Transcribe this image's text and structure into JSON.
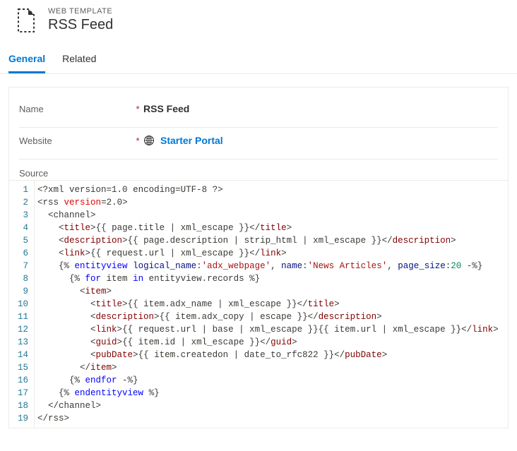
{
  "header": {
    "category": "WEB TEMPLATE",
    "title": "RSS Feed"
  },
  "tabs": {
    "general": "General",
    "related": "Related"
  },
  "fields": {
    "name_label": "Name",
    "name_value": "RSS Feed",
    "website_label": "Website",
    "website_value": "Starter Portal",
    "source_label": "Source"
  },
  "code": {
    "lines": [
      {
        "n": 1,
        "indent": 0,
        "segs": [
          {
            "t": "<?",
            "c": "t-pun"
          },
          {
            "t": "xml version",
            "c": "t-dk"
          },
          {
            "t": "=",
            "c": "t-pun"
          },
          {
            "t": "1.0",
            "c": "t-dk"
          },
          {
            "t": " encoding",
            "c": "t-dk"
          },
          {
            "t": "=",
            "c": "t-pun"
          },
          {
            "t": "UTF-8",
            "c": "t-dk"
          },
          {
            "t": " ?>",
            "c": "t-pun"
          }
        ]
      },
      {
        "n": 2,
        "indent": 0,
        "segs": [
          {
            "t": "<",
            "c": "t-pun"
          },
          {
            "t": "rss",
            "c": "t-dk"
          },
          {
            "t": " ",
            "c": ""
          },
          {
            "t": "version",
            "c": "t-attr"
          },
          {
            "t": "=",
            "c": "t-pun"
          },
          {
            "t": "2.0",
            "c": "t-dk"
          },
          {
            "t": ">",
            "c": "t-pun"
          }
        ]
      },
      {
        "n": 3,
        "indent": 1,
        "segs": [
          {
            "t": "<",
            "c": "t-pun"
          },
          {
            "t": "channel",
            "c": "t-dk"
          },
          {
            "t": ">",
            "c": "t-pun"
          }
        ]
      },
      {
        "n": 4,
        "indent": 2,
        "segs": [
          {
            "t": "<",
            "c": "t-pun"
          },
          {
            "t": "title",
            "c": "t-tag"
          },
          {
            "t": ">",
            "c": "t-pun"
          },
          {
            "t": "{{ page.title | xml_escape }}",
            "c": "t-dk"
          },
          {
            "t": "</",
            "c": "t-pun"
          },
          {
            "t": "title",
            "c": "t-tag"
          },
          {
            "t": ">",
            "c": "t-pun"
          }
        ]
      },
      {
        "n": 5,
        "indent": 2,
        "segs": [
          {
            "t": "<",
            "c": "t-pun"
          },
          {
            "t": "description",
            "c": "t-tag"
          },
          {
            "t": ">",
            "c": "t-pun"
          },
          {
            "t": "{{ page.description | strip_html | xml_escape }}",
            "c": "t-dk"
          },
          {
            "t": "</",
            "c": "t-pun"
          },
          {
            "t": "description",
            "c": "t-tag"
          },
          {
            "t": ">",
            "c": "t-pun"
          }
        ]
      },
      {
        "n": 6,
        "indent": 2,
        "segs": [
          {
            "t": "<",
            "c": "t-pun"
          },
          {
            "t": "link",
            "c": "t-tag"
          },
          {
            "t": ">",
            "c": "t-pun"
          },
          {
            "t": "{{ request.url | xml_escape }}",
            "c": "t-dk"
          },
          {
            "t": "</",
            "c": "t-pun"
          },
          {
            "t": "link",
            "c": "t-tag"
          },
          {
            "t": ">",
            "c": "t-pun"
          }
        ]
      },
      {
        "n": 7,
        "indent": 2,
        "segs": [
          {
            "t": "{% ",
            "c": "t-pct"
          },
          {
            "t": "entityview",
            "c": "t-kw"
          },
          {
            "t": " ",
            "c": ""
          },
          {
            "t": "logical_name",
            "c": "t-var"
          },
          {
            "t": ":",
            "c": "t-pun"
          },
          {
            "t": "'adx_webpage'",
            "c": "t-str"
          },
          {
            "t": ", ",
            "c": "t-pun"
          },
          {
            "t": "name",
            "c": "t-var"
          },
          {
            "t": ":",
            "c": "t-pun"
          },
          {
            "t": "'News Articles'",
            "c": "t-str"
          },
          {
            "t": ", ",
            "c": "t-pun"
          },
          {
            "t": "page_size",
            "c": "t-var"
          },
          {
            "t": ":",
            "c": "t-pun"
          },
          {
            "t": "20",
            "c": "t-num"
          },
          {
            "t": " -%}",
            "c": "t-pct"
          }
        ]
      },
      {
        "n": 8,
        "indent": 3,
        "segs": [
          {
            "t": "{% ",
            "c": "t-pct"
          },
          {
            "t": "for",
            "c": "t-kw"
          },
          {
            "t": " item ",
            "c": "t-dk"
          },
          {
            "t": "in",
            "c": "t-kw"
          },
          {
            "t": " entityview.records ",
            "c": "t-dk"
          },
          {
            "t": "%}",
            "c": "t-pct"
          }
        ]
      },
      {
        "n": 9,
        "indent": 4,
        "segs": [
          {
            "t": "<",
            "c": "t-pun"
          },
          {
            "t": "item",
            "c": "t-tag"
          },
          {
            "t": ">",
            "c": "t-pun"
          }
        ]
      },
      {
        "n": 10,
        "indent": 5,
        "segs": [
          {
            "t": "<",
            "c": "t-pun"
          },
          {
            "t": "title",
            "c": "t-tag"
          },
          {
            "t": ">",
            "c": "t-pun"
          },
          {
            "t": "{{ item.adx_name | xml_escape }}",
            "c": "t-dk"
          },
          {
            "t": "</",
            "c": "t-pun"
          },
          {
            "t": "title",
            "c": "t-tag"
          },
          {
            "t": ">",
            "c": "t-pun"
          }
        ]
      },
      {
        "n": 11,
        "indent": 5,
        "segs": [
          {
            "t": "<",
            "c": "t-pun"
          },
          {
            "t": "description",
            "c": "t-tag"
          },
          {
            "t": ">",
            "c": "t-pun"
          },
          {
            "t": "{{ item.adx_copy | escape }}",
            "c": "t-dk"
          },
          {
            "t": "</",
            "c": "t-pun"
          },
          {
            "t": "description",
            "c": "t-tag"
          },
          {
            "t": ">",
            "c": "t-pun"
          }
        ]
      },
      {
        "n": 12,
        "indent": 5,
        "segs": [
          {
            "t": "<",
            "c": "t-pun"
          },
          {
            "t": "link",
            "c": "t-tag"
          },
          {
            "t": ">",
            "c": "t-pun"
          },
          {
            "t": "{{ request.url | base | xml_escape }}{{ item.url | xml_escape }}",
            "c": "t-dk"
          },
          {
            "t": "</",
            "c": "t-pun"
          },
          {
            "t": "link",
            "c": "t-tag"
          },
          {
            "t": ">",
            "c": "t-pun"
          }
        ]
      },
      {
        "n": 13,
        "indent": 5,
        "segs": [
          {
            "t": "<",
            "c": "t-pun"
          },
          {
            "t": "guid",
            "c": "t-tag"
          },
          {
            "t": ">",
            "c": "t-pun"
          },
          {
            "t": "{{ item.id | xml_escape }}",
            "c": "t-dk"
          },
          {
            "t": "</",
            "c": "t-pun"
          },
          {
            "t": "guid",
            "c": "t-tag"
          },
          {
            "t": ">",
            "c": "t-pun"
          }
        ]
      },
      {
        "n": 14,
        "indent": 5,
        "segs": [
          {
            "t": "<",
            "c": "t-pun"
          },
          {
            "t": "pubDate",
            "c": "t-tag"
          },
          {
            "t": ">",
            "c": "t-pun"
          },
          {
            "t": "{{ item.createdon | date_to_rfc822 }}",
            "c": "t-dk"
          },
          {
            "t": "</",
            "c": "t-pun"
          },
          {
            "t": "pubDate",
            "c": "t-tag"
          },
          {
            "t": ">",
            "c": "t-pun"
          }
        ]
      },
      {
        "n": 15,
        "indent": 4,
        "segs": [
          {
            "t": "</",
            "c": "t-pun"
          },
          {
            "t": "item",
            "c": "t-tag"
          },
          {
            "t": ">",
            "c": "t-pun"
          }
        ]
      },
      {
        "n": 16,
        "indent": 3,
        "segs": [
          {
            "t": "{% ",
            "c": "t-pct"
          },
          {
            "t": "endfor",
            "c": "t-kw"
          },
          {
            "t": " -%}",
            "c": "t-pct"
          }
        ]
      },
      {
        "n": 17,
        "indent": 2,
        "segs": [
          {
            "t": "{% ",
            "c": "t-pct"
          },
          {
            "t": "endentityview",
            "c": "t-kw"
          },
          {
            "t": " %}",
            "c": "t-pct"
          }
        ]
      },
      {
        "n": 18,
        "indent": 1,
        "segs": [
          {
            "t": "</",
            "c": "t-pun"
          },
          {
            "t": "channel",
            "c": "t-dk"
          },
          {
            "t": ">",
            "c": "t-pun"
          }
        ]
      },
      {
        "n": 19,
        "indent": 0,
        "segs": [
          {
            "t": "</",
            "c": "t-pun"
          },
          {
            "t": "rss",
            "c": "t-dk"
          },
          {
            "t": ">",
            "c": "t-pun"
          }
        ]
      }
    ]
  }
}
